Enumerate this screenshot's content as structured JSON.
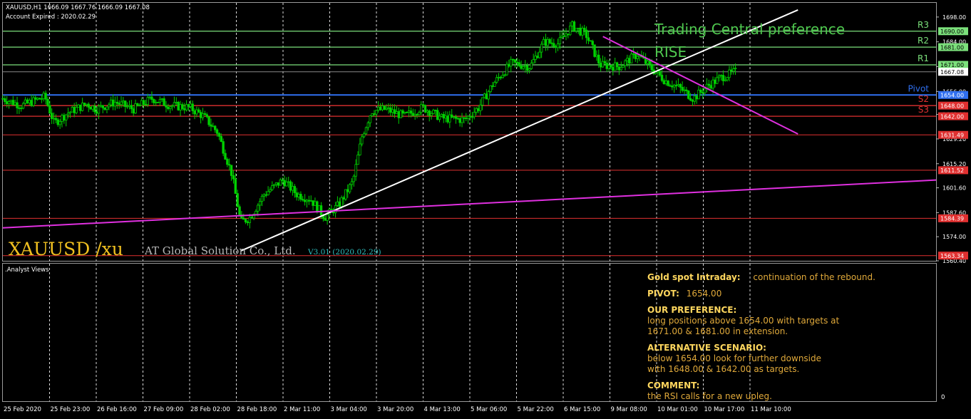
{
  "header": {
    "symbol_line": "XAUUSD,H1  1666.09 1667.76 1666.09 1667.08",
    "account_line": "Account Expired : 2020.02.29"
  },
  "overlay": {
    "preference_title": "Trading Central preference",
    "preference_value": "RISE",
    "brand": "XAUUSD /xu",
    "company": "AT Global Solution Co., Ltd.",
    "version": "V3.01 (2020.02.29)"
  },
  "subwindow": {
    "label": ".Analyst Views",
    "zero_label": "0"
  },
  "analyst": {
    "heading_label": "Gold spot Intraday:",
    "heading_value": "continuation of the rebound.",
    "pivot_label": "PIVOT:",
    "pivot_value": "1654.00",
    "pref_label": "OUR PREFERENCE:",
    "pref_line1": "long positions above 1654.00 with targets at",
    "pref_line2": "1671.00 & 1681.00 in extension.",
    "alt_label": "ALTERNATIVE SCENARIO:",
    "alt_line1": "below 1654.00 look for further downside",
    "alt_line2": "with 1648.00 & 1642.00 as targets.",
    "comment_label": "COMMENT:",
    "comment_line1": "the RSI calls for a new upleg."
  },
  "colors": {
    "background": "#000000",
    "bull_candle": "#00d000",
    "bear_candle": "#00d000",
    "grid": "#ffffff",
    "resistance": "#7be07b",
    "pivot": "#2f6ff0",
    "support": "#e03030",
    "trend_white": "#ffffff",
    "trend_magenta": "#e030e0",
    "title_green": "#4fc84f",
    "brand_gold": "#f0c020",
    "version_cyan": "#2ec0c0"
  },
  "chart_data": {
    "type": "candlestick",
    "symbol": "XAUUSD",
    "timeframe": "H1",
    "ylim": [
      1560.4,
      1706.0
    ],
    "yticks": [
      1698.0,
      1684.0,
      1670.0,
      1656.0,
      1643.0,
      1629.2,
      1615.2,
      1601.6,
      1587.6,
      1574.0,
      1560.4
    ],
    "x_labels": [
      "25 Feb 2020",
      "25 Feb 23:00",
      "26 Feb 16:00",
      "27 Feb 09:00",
      "28 Feb 02:00",
      "28 Feb 18:00",
      "2 Mar 11:00",
      "3 Mar 04:00",
      "3 Mar 20:00",
      "4 Mar 13:00",
      "5 Mar 06:00",
      "5 Mar 22:00",
      "6 Mar 15:00",
      "9 Mar 08:00",
      "10 Mar 01:00",
      "10 Mar 17:00",
      "11 Mar 10:00"
    ],
    "current_price": 1667.08,
    "levels": [
      {
        "name": "R3",
        "value": 1690.0,
        "label": "1690.00",
        "kind": "resistance"
      },
      {
        "name": "R2",
        "value": 1681.0,
        "label": "1681.00",
        "kind": "resistance"
      },
      {
        "name": "R1",
        "value": 1671.0,
        "label": "1671.00",
        "kind": "resistance"
      },
      {
        "name": "Pivot",
        "value": 1654.0,
        "label": "1654.00",
        "kind": "pivot"
      },
      {
        "name": "S2",
        "value": 1648.0,
        "label": "1648.00",
        "kind": "support"
      },
      {
        "name": "S3",
        "value": 1642.0,
        "label": "1642.00",
        "kind": "support"
      },
      {
        "name": "",
        "value": 1631.49,
        "label": "1631.49",
        "kind": "support-minor"
      },
      {
        "name": "",
        "value": 1611.52,
        "label": "1611.52",
        "kind": "support-minor"
      },
      {
        "name": "",
        "value": 1584.39,
        "label": "1584.39",
        "kind": "support-minor"
      },
      {
        "name": "",
        "value": 1563.34,
        "label": "1563.34",
        "kind": "support-minor"
      }
    ],
    "trendlines": [
      {
        "color": "white",
        "points": [
          [
            0.255,
            1566.0
          ],
          [
            0.852,
            1702.0
          ]
        ]
      },
      {
        "color": "magenta",
        "points": [
          [
            0.643,
            1687.0
          ],
          [
            0.852,
            1632.0
          ]
        ]
      },
      {
        "color": "magenta",
        "points": [
          [
            0.0,
            1579.0
          ],
          [
            1.0,
            1606.0
          ]
        ]
      }
    ],
    "close_path": [
      [
        0.0,
        1652
      ],
      [
        0.02,
        1648
      ],
      [
        0.045,
        1653
      ],
      [
        0.055,
        1638
      ],
      [
        0.07,
        1644
      ],
      [
        0.09,
        1649
      ],
      [
        0.1,
        1646
      ],
      [
        0.12,
        1650
      ],
      [
        0.14,
        1646
      ],
      [
        0.16,
        1652
      ],
      [
        0.18,
        1648
      ],
      [
        0.2,
        1647
      ],
      [
        0.215,
        1642
      ],
      [
        0.23,
        1633
      ],
      [
        0.245,
        1610
      ],
      [
        0.255,
        1582
      ],
      [
        0.265,
        1585
      ],
      [
        0.28,
        1598
      ],
      [
        0.3,
        1606
      ],
      [
        0.315,
        1598
      ],
      [
        0.33,
        1595
      ],
      [
        0.345,
        1585
      ],
      [
        0.36,
        1592
      ],
      [
        0.375,
        1605
      ],
      [
        0.385,
        1631
      ],
      [
        0.395,
        1645
      ],
      [
        0.41,
        1646
      ],
      [
        0.43,
        1642
      ],
      [
        0.45,
        1647
      ],
      [
        0.47,
        1641
      ],
      [
        0.495,
        1640
      ],
      [
        0.51,
        1647
      ],
      [
        0.525,
        1660
      ],
      [
        0.545,
        1672
      ],
      [
        0.565,
        1670
      ],
      [
        0.58,
        1684
      ],
      [
        0.595,
        1683
      ],
      [
        0.61,
        1693
      ],
      [
        0.625,
        1688
      ],
      [
        0.64,
        1671
      ],
      [
        0.66,
        1670
      ],
      [
        0.68,
        1677
      ],
      [
        0.695,
        1669
      ],
      [
        0.71,
        1662
      ],
      [
        0.725,
        1658
      ],
      [
        0.74,
        1652
      ],
      [
        0.755,
        1659
      ],
      [
        0.77,
        1664
      ],
      [
        0.785,
        1667.08
      ]
    ]
  }
}
